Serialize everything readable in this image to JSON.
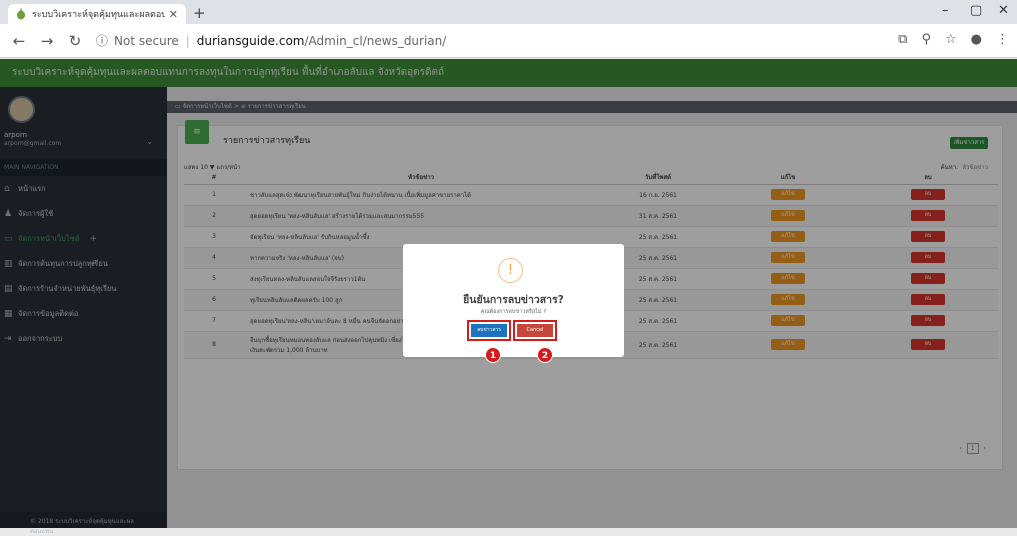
{
  "browser": {
    "tab_title": "ระบบวิเคราะห์จุดคุ้มทุนและผลตอบแทน",
    "new_tab": "+",
    "url_info": "ⓘ",
    "url_not_secure": "Not secure",
    "url_host": "duriansguide.com",
    "url_path": "/Admin_cl/news_durian/",
    "win_min": "–",
    "win_max": "▢",
    "win_close": "✕"
  },
  "app": {
    "header_title": "ระบบวิเคราะห์จุดคุ้มทุนและผลตอบแทนการลงทุนในการปลูกทุเรียน พื้นที่อำเภอลับแล จังหวัดอุตรดิตถ์"
  },
  "sidebar": {
    "user_name": "arporn",
    "user_email": "arporn@gmail.com",
    "nav_header": "MAIN NAVIGATION",
    "items": [
      {
        "label": "หน้าแรก",
        "icon": "home-icon",
        "glyph": "⌂",
        "plus": ""
      },
      {
        "label": "จัดการผู้ใช้",
        "icon": "user-icon",
        "glyph": "♟",
        "plus": ""
      },
      {
        "label": "จัดการหน้าเว็บไซต์",
        "icon": "window-icon",
        "glyph": "▭",
        "plus": "+"
      },
      {
        "label": "จัดการต้นทุนการปลูกทุเรียน",
        "icon": "chart-icon",
        "glyph": "▥",
        "plus": "+"
      },
      {
        "label": "จัดการร้านจำหน่ายพันธุ์ทุเรียน",
        "icon": "store-icon",
        "glyph": "▤",
        "plus": ""
      },
      {
        "label": "จัดการข้อมูลติดต่อ",
        "icon": "contact-icon",
        "glyph": "▦",
        "plus": ""
      },
      {
        "label": "ออกจากระบบ",
        "icon": "logout-icon",
        "glyph": "⇥",
        "plus": ""
      }
    ],
    "footer": "© 2018 ระบบวิเคราะห์จุดคุ้มทุนและผลตอบแทน"
  },
  "content": {
    "breadcrumb": "▭ จัดการหน้าเว็บไซต์ > ≡ รายการข่าวสารทุเรียน",
    "box_title": "รายการข่าวสารทุเรียน",
    "add_button": "เพิ่มข่าวสาร",
    "length_label": "แสดง 10 ▼ แถว/หน้า",
    "search_label": "ค้นหา:",
    "search_placeholder": "หัวข้อข่าว",
    "columns": [
      "#",
      "หัวข้อข่าว",
      "วันที่โพสต์",
      "แก้ไข",
      "ลบ"
    ],
    "edit_label": "แก้ไข",
    "delete_label": "ลบ",
    "rows": [
      {
        "no": "1",
        "title": "ชาวลับแลสุดเจ๋ง พัฒนาทุเรียนสายพันธุ์ใหม่ กินง่ายได้ทนาน เนื้อเพิ่มมูลค่าขายราคาได้",
        "date": "16 ก.ย. 2561"
      },
      {
        "no": "2",
        "title": "สุดยอดทุเรียน 'หลง-หลินลับแล' สร้างรายได้รวมและสนมากรรม555",
        "date": "31 ส.ค. 2561"
      },
      {
        "no": "3",
        "title": "จัดทุเรียน 'หลง-หลินลับแล' รับกินหลอมูนน้ำซึ้ง",
        "date": "25 ส.ค. 2561"
      },
      {
        "no": "4",
        "title": "หากความจริง 'หลง-หลินลับแล' (จบ)",
        "date": "25 ส.ค. 2561"
      },
      {
        "no": "5",
        "title": "ส่งทุเรียนหลง-หลินลับแลสอบใจจีรังยราว1ต้น",
        "date": "25 ส.ค. 2561"
      },
      {
        "no": "6",
        "title": "ทุเรียนหลินลับแลติดผลครับ 100 ลูก",
        "date": "25 ส.ค. 2561"
      },
      {
        "no": "7",
        "title": "สุดยอดทุเรียน'หลง-หลิน'เหมาอ้นละ 8 หมื่น คนจีนจัดอกอย่าง",
        "date": "25 ส.ค. 2561"
      },
      {
        "no": "8",
        "title": "จีนบุกซื้อทุเรียนหมอนทองลับแล ก่อนส่งออกไปคุนหมิง เซี่ยงไฮ้ ปักกิ่ง กวางโจว ช่วงคราว ช่องละ 30 ตัน สร้างประวัติศาสตร์ใหม่ คาดเงินสะพัดรวม 1,000 ล้านบาท",
        "date": "25 ส.ค. 2561"
      }
    ],
    "pager_prev": "‹",
    "pager_page": "1",
    "pager_next": "›"
  },
  "modal": {
    "icon": "!",
    "title": "ยืนยันการลบข่าวสาร?",
    "text": "คุณต้องการลบข่าวหรือไม่ ?",
    "confirm_label": "ลบข่าวสาร",
    "cancel_label": "Cancel",
    "badge_1": "1",
    "badge_2": "2"
  },
  "colors": {
    "header_green": "#3f8f3a",
    "sidebar": "#2a3139",
    "edit_orange": "#ef9a22",
    "delete_red": "#d9352c",
    "confirm_blue": "#1e73be",
    "highlight_red": "#d41c1c"
  }
}
